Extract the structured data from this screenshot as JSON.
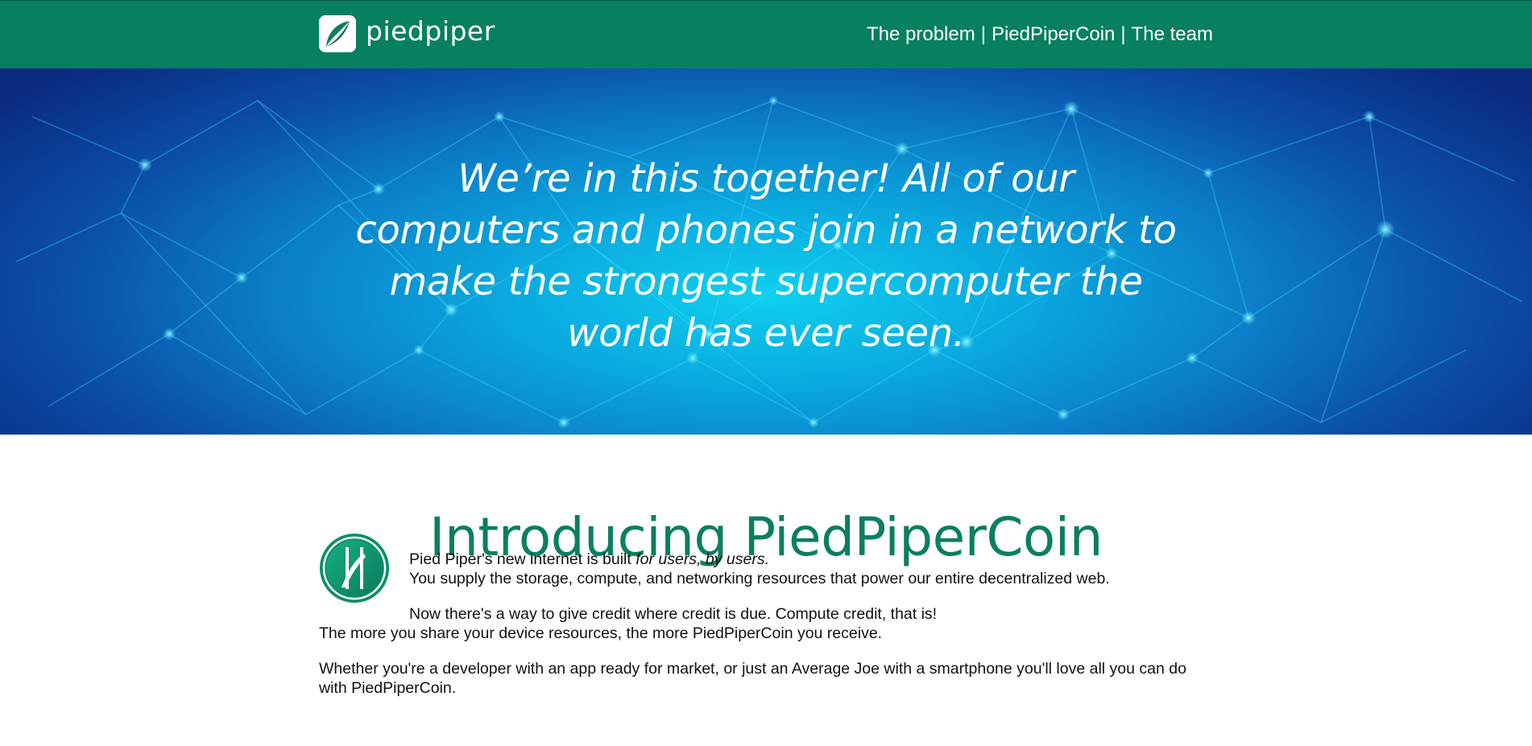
{
  "header": {
    "logo_text": "piedpiper",
    "nav": [
      {
        "label": "The problem"
      },
      {
        "label": "PiedPiperCoin"
      },
      {
        "label": "The team"
      }
    ],
    "nav_separator": "|"
  },
  "hero": {
    "quote": "We’re in this together! All of our computers and phones join in a network to make the strongest supercomputer the world has ever seen."
  },
  "intro": {
    "title": "Introducing PiedPiperCoin",
    "line1_prefix": "Pied Piper's new internet is built ",
    "line1_emphasis": "for users, by users.",
    "line2": "You supply the storage, compute, and networking resources that power our entire decentralized web.",
    "line3": "Now there's a way to give credit where credit is due. Compute credit, that is!",
    "line4": "The more you share your device resources, the more PiedPiperCoin you receive.",
    "line5": "Whether you're a developer with an app ready for market, or just an Average Joe with a smartphone you'll love all you can do with PiedPiperCoin."
  },
  "colors": {
    "brand_green": "#07805f",
    "title_green": "#0a7f5f",
    "hero_cyan": "#0fd0ef",
    "hero_navy": "#0a2a80"
  }
}
